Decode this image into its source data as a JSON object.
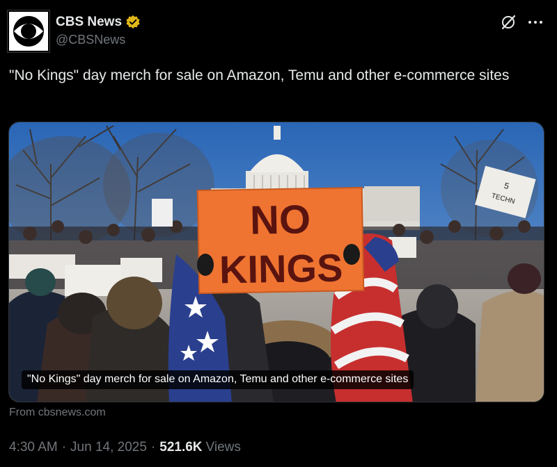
{
  "tweet": {
    "author": {
      "display_name": "CBS News",
      "handle": "@CBSNews",
      "verified": true,
      "avatar_icon": "cbs-eye-logo"
    },
    "actions": {
      "grok_icon": "grok-icon",
      "more_icon": "more-icon"
    },
    "text": "\"No Kings\" day merch for sale on Amazon, Temu and other e-commerce sites",
    "media": {
      "caption": "\"No Kings\" day merch for sale on Amazon, Temu and other e-commerce sites",
      "sign_text_line1": "NO",
      "sign_text_line2": "KINGS",
      "small_sign_text": "5 TECHN"
    },
    "source": "From cbsnews.com",
    "time": "4:30 AM",
    "date": "Jun 14, 2025",
    "separator": "·",
    "views_count": "521.6K",
    "views_label": "Views"
  },
  "colors": {
    "background": "#000000",
    "text_primary": "#e7e9ea",
    "text_secondary": "#71767b",
    "verified_gold": "#e2b719",
    "sign_orange": "#ef7431",
    "sign_text": "#5a1410",
    "sky": "#2f6fb8"
  }
}
